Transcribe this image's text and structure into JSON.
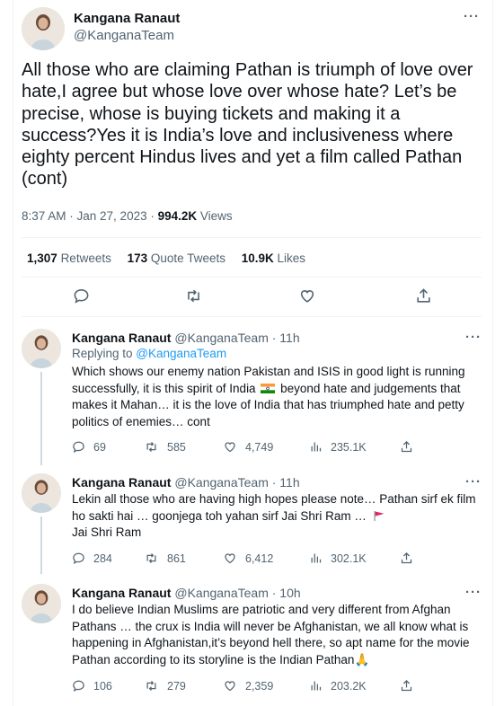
{
  "main_tweet": {
    "author": "Kangana Ranaut",
    "handle": "@KanganaTeam",
    "text": "All those who are claiming Pathan is triumph of love over hate,I agree but whose love over whose hate? Let’s be precise, whose is buying tickets and making it a success?Yes it is India’s love and inclusiveness where eighty percent Hindus lives and yet a film called Pathan (cont)",
    "time": "8:37 AM · Jan 27, 2023 · ",
    "views_count": "994.2K",
    "views_label": " Views",
    "retweets_count": "1,307",
    "retweets_label": "Retweets",
    "quotes_count": "173",
    "quotes_label": "Quote Tweets",
    "likes_count": "10.9K",
    "likes_label": "Likes"
  },
  "replies": [
    {
      "author": "Kangana Ranaut",
      "handle_time": "@KanganaTeam · 11h",
      "replying_prefix": "Replying to ",
      "replying_to": "@KanganaTeam",
      "text_a": "Which shows our enemy nation Pakistan and ISIS in good light is running successfully, it is this spirit of India ",
      "text_b": " beyond hate and judgements that makes it Mahan… it is the love of India that has triumphed hate and petty politics of enemies… cont",
      "replies": "69",
      "retweets": "585",
      "likes": "4,749",
      "views": "235.1K"
    },
    {
      "author": "Kangana Ranaut",
      "handle_time": "@KanganaTeam · 11h",
      "text_a": "Lekin all those who are having high hopes please note… Pathan sirf ek film ho sakti hai … goonjega toh yahan sirf Jai Shri Ram … ",
      "text_b": "Jai Shri Ram",
      "replies": "284",
      "retweets": "861",
      "likes": "6,412",
      "views": "302.1K"
    },
    {
      "author": "Kangana Ranaut",
      "handle_time": "@KanganaTeam · 10h",
      "text_a": "I do believe Indian Muslims are patriotic and very different from Afghan Pathans … the crux is India will never be Afghanistan, we all know what is happening in Afghanistan,it’s beyond hell there, so apt name for the movie Pathan according to its storyline is the Indian Pathan",
      "text_emoji": "🙏",
      "replies": "106",
      "retweets": "279",
      "likes": "2,359",
      "views": "203.2K"
    }
  ],
  "colors": {
    "text": "#0f1419",
    "secondary": "#536471",
    "link": "#1d9bf0",
    "divider": "#eff3f4"
  },
  "icons": [
    "more-icon",
    "reply-icon",
    "retweet-icon",
    "like-icon",
    "views-icon",
    "share-icon",
    "india-flag-icon",
    "red-flag-icon",
    "folded-hands-icon"
  ]
}
